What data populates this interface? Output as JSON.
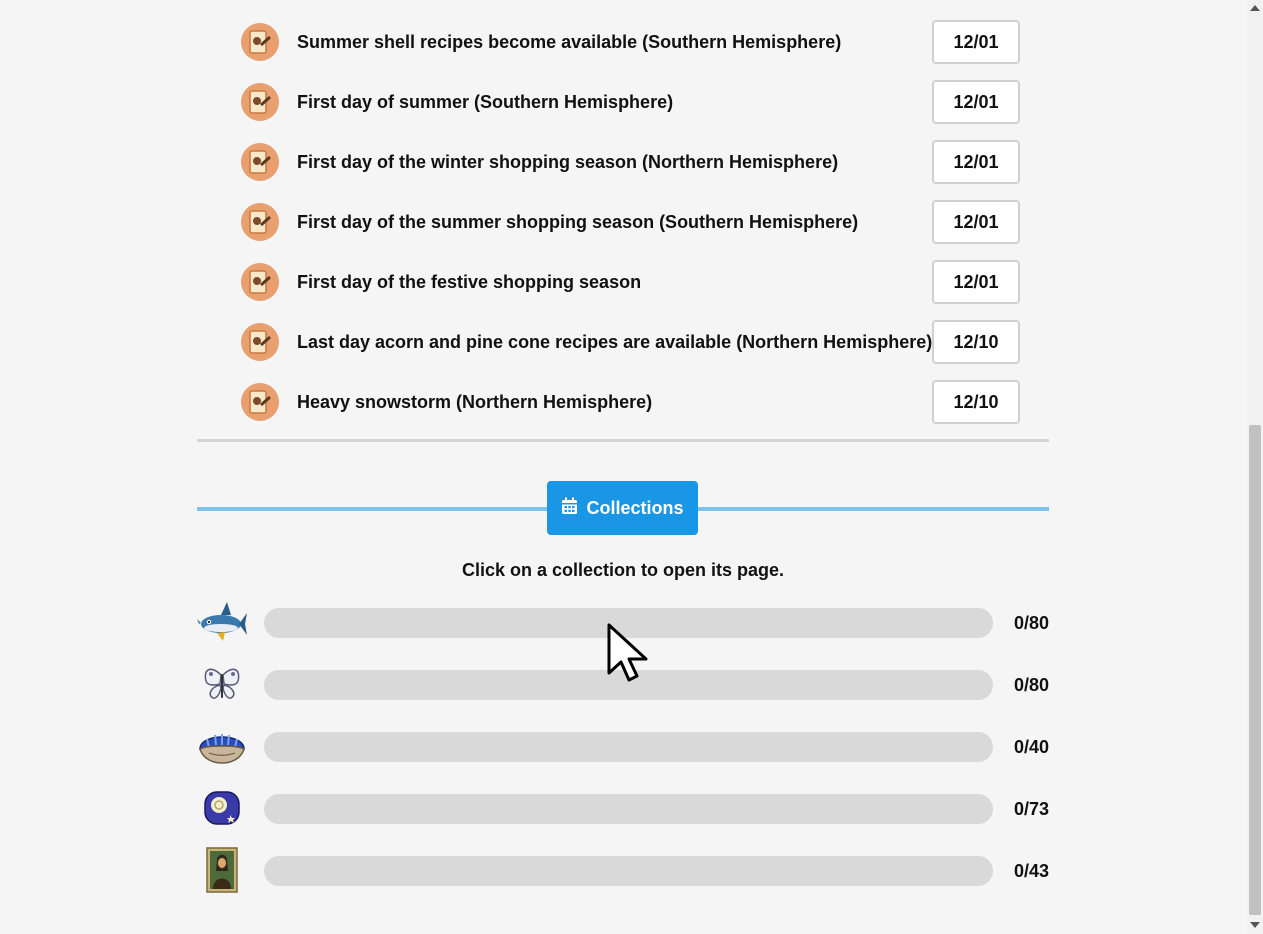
{
  "events": [
    {
      "label": "Summer shell recipes become available (Southern Hemisphere)",
      "date": "12/01",
      "icon": "diy-recipe-icon"
    },
    {
      "label": "First day of summer (Southern Hemisphere)",
      "date": "12/01",
      "icon": "diy-recipe-icon"
    },
    {
      "label": "First day of the winter shopping season (Northern Hemisphere)",
      "date": "12/01",
      "icon": "diy-recipe-icon"
    },
    {
      "label": "First day of the summer shopping season (Southern Hemisphere)",
      "date": "12/01",
      "icon": "diy-recipe-icon"
    },
    {
      "label": "First day of the festive shopping season",
      "date": "12/01",
      "icon": "diy-recipe-icon"
    },
    {
      "label": "Last day acorn and pine cone recipes are available (Northern Hemisphere)",
      "date": "12/10",
      "icon": "diy-recipe-icon"
    },
    {
      "label": "Heavy snowstorm (Northern Hemisphere)",
      "date": "12/10",
      "icon": "diy-recipe-icon"
    }
  ],
  "collections_section": {
    "button_label": "Collections",
    "button_icon": "calendar-icon",
    "hint": "Click on a collection to open its page."
  },
  "collections": [
    {
      "icon": "fish-icon",
      "count": "0/80",
      "progress": 0
    },
    {
      "icon": "butterfly-icon",
      "count": "0/80",
      "progress": 0
    },
    {
      "icon": "clam-icon",
      "count": "0/40",
      "progress": 0
    },
    {
      "icon": "fossil-icon",
      "count": "0/73",
      "progress": 0
    },
    {
      "icon": "painting-icon",
      "count": "0/43",
      "progress": 0
    }
  ],
  "colors": {
    "accent": "#1a96e6",
    "accent_line": "#7ec2ec",
    "bar_track": "#d9d9d9",
    "icon_badge": "#e9a070"
  }
}
